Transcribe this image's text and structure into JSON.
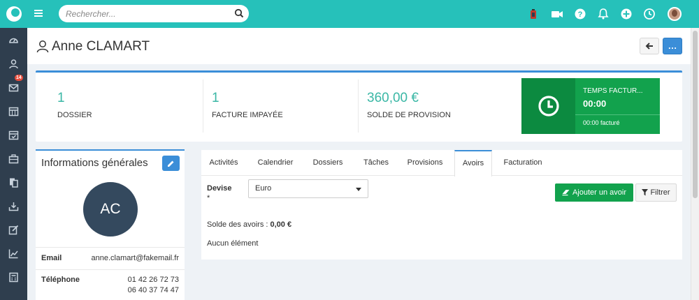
{
  "topbar": {
    "search_placeholder": "Rechercher...",
    "icons": [
      "logo-icon",
      "menu-icon",
      "search-icon",
      "timer-stopwatch-icon",
      "video-icon",
      "help-icon",
      "bell-icon",
      "plus-icon",
      "clock-icon",
      "user-avatar"
    ]
  },
  "sidebar": {
    "items": [
      {
        "icon": "dashboard-icon"
      },
      {
        "icon": "contacts-icon"
      },
      {
        "icon": "mail-icon",
        "badge": "14"
      },
      {
        "icon": "calendar-icon"
      },
      {
        "icon": "calendar-check-icon"
      },
      {
        "icon": "briefcase-icon"
      },
      {
        "icon": "documents-icon"
      },
      {
        "icon": "inbox-tray-icon"
      },
      {
        "icon": "edit-icon"
      },
      {
        "icon": "chart-icon"
      },
      {
        "icon": "calculator-icon"
      }
    ]
  },
  "header": {
    "title": "Anne CLAMART",
    "more_label": "…"
  },
  "stats": [
    {
      "value": "1",
      "label": "DOSSIER"
    },
    {
      "value": "1",
      "label": "FACTURE IMPAYÉE"
    },
    {
      "value": "360,00 €",
      "label": "SOLDE DE PROVISION"
    }
  ],
  "timer": {
    "title": "TEMPS FACTUR...",
    "time": "00:00",
    "billed": "00:00 facturé"
  },
  "info": {
    "title": "Informations générales",
    "initials": "AC",
    "email_label": "Email",
    "email_value": "anne.clamart@fakemail.fr",
    "phone_label": "Téléphone",
    "phone_1": "01 42 26 72 73",
    "phone_2": "06 40 37 74 47"
  },
  "tabs": [
    "Activités",
    "Calendrier",
    "Dossiers",
    "Tâches",
    "Provisions",
    "Avoirs",
    "Facturation"
  ],
  "active_tab": "Avoirs",
  "avoirs": {
    "devise_label": "Devise",
    "required_mark": "*",
    "devise_value": "Euro",
    "add_button": "Ajouter un avoir",
    "filter_button": "Filtrer",
    "solde_label": "Solde des avoirs : ",
    "solde_value": "0,00 €",
    "empty_text": "Aucun élément"
  },
  "colors": {
    "topbar": "#26c1ba",
    "sidebar": "#2f3e4e",
    "accent_blue": "#3b8ed8",
    "green": "#12a24d",
    "stat_value": "#3ab7a5"
  }
}
